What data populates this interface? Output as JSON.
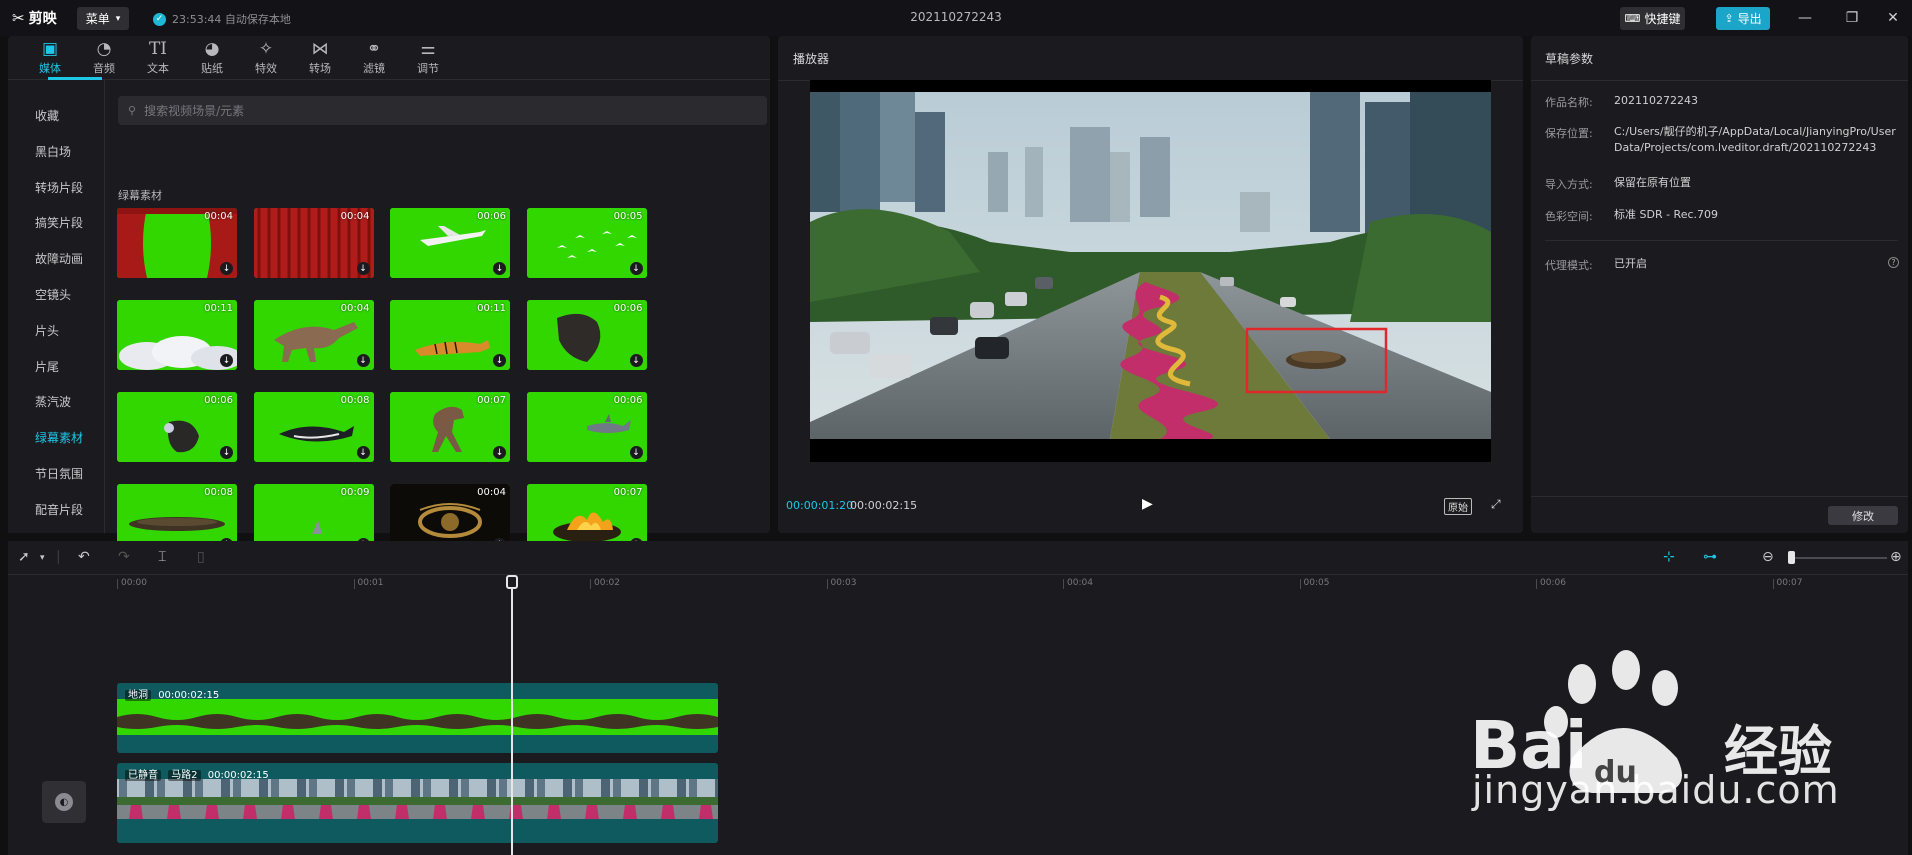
{
  "app": {
    "name": "剪映",
    "menu_label": "菜单",
    "autosave_text": "23:53:44 自动保存本地",
    "window_title": "202110272243",
    "shortcut_label": "快捷键",
    "export_label": "导出"
  },
  "toolbar": [
    {
      "label": "媒体",
      "icon": "media-icon"
    },
    {
      "label": "音频",
      "icon": "audio-icon"
    },
    {
      "label": "文本",
      "icon": "text-icon"
    },
    {
      "label": "贴纸",
      "icon": "sticker-icon"
    },
    {
      "label": "特效",
      "icon": "effects-icon"
    },
    {
      "label": "转场",
      "icon": "transition-icon"
    },
    {
      "label": "滤镜",
      "icon": "filter-icon"
    },
    {
      "label": "调节",
      "icon": "adjust-icon"
    }
  ],
  "categories": [
    "收藏",
    "黑白场",
    "转场片段",
    "搞笑片段",
    "故障动画",
    "空镜头",
    "片头",
    "片尾",
    "蒸汽波",
    "绿幕素材",
    "节日氛围",
    "配音片段"
  ],
  "active_category": "绿幕素材",
  "search": {
    "placeholder": "搜索视频场景/元素"
  },
  "section_title": "绿幕素材",
  "materials": [
    {
      "duration": "00:04",
      "kind": "curtain-green"
    },
    {
      "duration": "00:04",
      "kind": "curtain-red"
    },
    {
      "duration": "00:06",
      "kind": "plane"
    },
    {
      "duration": "00:05",
      "kind": "birds"
    },
    {
      "duration": "00:11",
      "kind": "clouds"
    },
    {
      "duration": "00:04",
      "kind": "dinosaur"
    },
    {
      "duration": "00:11",
      "kind": "tiger"
    },
    {
      "duration": "00:06",
      "kind": "rock"
    },
    {
      "duration": "00:06",
      "kind": "meteor"
    },
    {
      "duration": "00:08",
      "kind": "whale"
    },
    {
      "duration": "00:07",
      "kind": "trex"
    },
    {
      "duration": "00:06",
      "kind": "shark"
    },
    {
      "duration": "00:08",
      "kind": "hole"
    },
    {
      "duration": "00:09",
      "kind": "fin"
    },
    {
      "duration": "00:04",
      "kind": "lion-logo"
    },
    {
      "duration": "00:07",
      "kind": "explosion"
    }
  ],
  "player": {
    "title": "播放器",
    "current_time": "00:00:01:20",
    "total_time": "00:00:02:15",
    "ratio_label": "原始"
  },
  "draft": {
    "title": "草稿参数",
    "fields": [
      {
        "label": "作品名称:",
        "value": "202110272243"
      },
      {
        "label": "保存位置:",
        "value": "C:/Users/靓仔的机子/AppData/Local/JianyingPro/User Data/Projects/com.lveditor.draft/202110272243"
      },
      {
        "label": "导入方式:",
        "value": "保留在原有位置"
      },
      {
        "label": "色彩空间:",
        "value": "标准 SDR - Rec.709"
      },
      {
        "label": "代理模式:",
        "value": "已开启"
      }
    ],
    "modify_label": "修改"
  },
  "timeline": {
    "ticks": [
      "00:00",
      "00:01",
      "00:02",
      "00:03",
      "00:04",
      "00:05",
      "00:06",
      "00:07"
    ],
    "tracks": [
      {
        "name": "地洞",
        "duration": "00:00:02:15"
      },
      {
        "mute": "已静音",
        "name": "马路2",
        "duration": "00:00:02:15"
      }
    ]
  },
  "watermark": {
    "brand": "Bai",
    "brand2": "du",
    "suffix": "经验",
    "url": "jingyan.baidu.com"
  },
  "colors": {
    "accent": "#1ec7e6",
    "green_screen": "#32d700",
    "track": "#0f5a5f"
  }
}
